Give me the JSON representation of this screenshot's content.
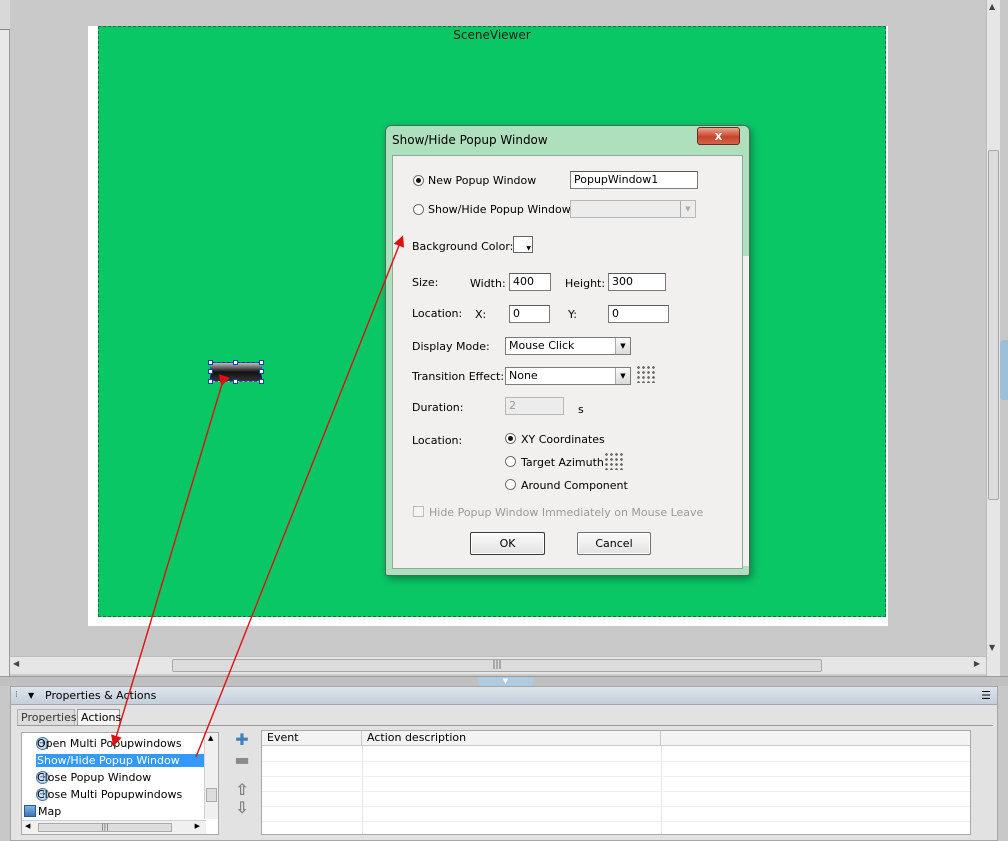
{
  "viewer": {
    "title": "SceneViewer"
  },
  "dialog": {
    "title": "Show/Hide Popup Window",
    "close_label": "x",
    "new_popup_label": "New Popup Window",
    "new_popup_value": "PopupWindow1",
    "new_popup_selected": true,
    "showhide_label": "Show/Hide Popup Window",
    "showhide_value": "",
    "bg_color_label": "Background Color:",
    "size_label": "Size:",
    "width_label": "Width:",
    "width_value": "400",
    "height_label": "Height:",
    "height_value": "300",
    "location_label": "Location:",
    "x_label": "X:",
    "x_value": "0",
    "y_label": "Y:",
    "y_value": "0",
    "display_mode_label": "Display Mode:",
    "display_mode_value": "Mouse Click",
    "transition_label": "Transition Effect:",
    "transition_value": "None",
    "duration_label": "Duration:",
    "duration_value": "2",
    "duration_unit": "s",
    "location2_label": "Location:",
    "loc_options": [
      "XY Coordinates",
      "Target Azimuth",
      "Around Component"
    ],
    "loc_selected": "XY Coordinates",
    "hide_checkbox_label": "Hide Popup Window Immediately on Mouse Leave",
    "hide_checkbox_checked": false,
    "ok_label": "OK",
    "cancel_label": "Cancel"
  },
  "panel": {
    "title": "Properties & Actions",
    "collapse_icon": "triangle-down-icon",
    "menu_icon": "panel-menu-icon",
    "tabs": [
      "Properties",
      "Actions"
    ],
    "active_tab": "Actions",
    "tree": {
      "items": [
        {
          "label": "Open Multi Popupwindows",
          "icon": "action-icon"
        },
        {
          "label": "Show/Hide Popup Window",
          "icon": "action-icon",
          "selected": true
        },
        {
          "label": "Close Popup Window",
          "icon": "action-icon"
        },
        {
          "label": "Close Multi Popupwindows",
          "icon": "action-icon"
        }
      ],
      "group": {
        "label": "Map",
        "icon": "folder-icon"
      }
    },
    "buttons": {
      "add_icon": "plus-icon",
      "remove_icon": "minus-icon",
      "up_icon": "arrow-up-icon",
      "down_icon": "arrow-down-icon"
    },
    "grid": {
      "columns": [
        "Event",
        "Action description",
        ""
      ],
      "rows": []
    }
  },
  "colors": {
    "scene_bg": "#0ac766",
    "dialog_frame": "#aee0bd",
    "close_button": "#c7432b",
    "selection": "#3399ff",
    "annotation_arrow": "#e01010"
  }
}
